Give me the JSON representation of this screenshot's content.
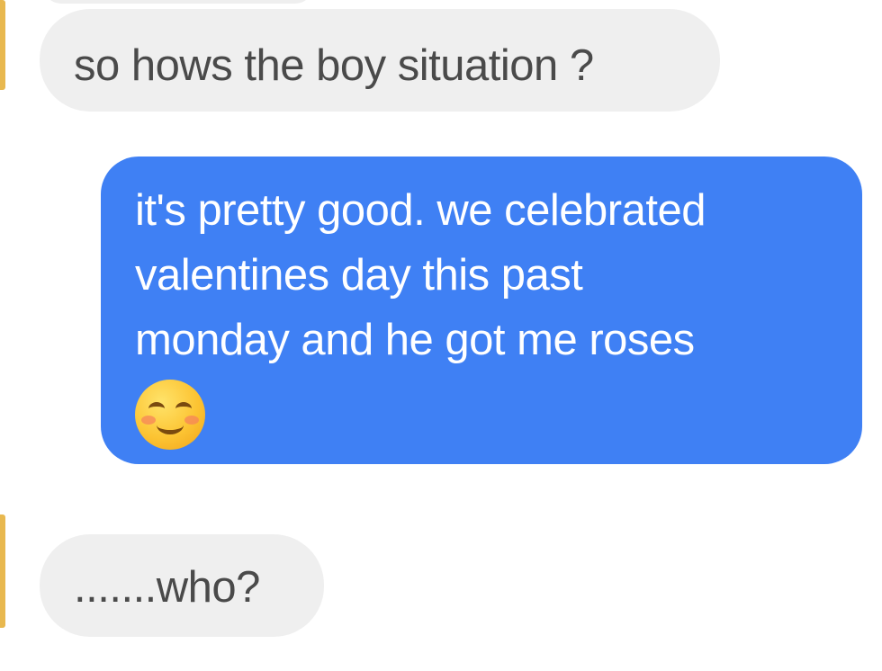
{
  "colors": {
    "sent_bubble": "#3f80f4",
    "received_bubble": "#efefef",
    "received_text": "#4a4a4a",
    "sent_text": "#ffffff",
    "avatar_accent": "#e8b84f"
  },
  "messages": [
    {
      "direction": "received",
      "text": "so hows the boy situation ?"
    },
    {
      "direction": "sent",
      "lines": [
        "it's pretty good. we celebrated",
        "valentines day this past",
        "monday and he got me roses"
      ],
      "emoji": "smiling-face-with-smiling-eyes"
    },
    {
      "direction": "received",
      "text": ".......who?"
    }
  ]
}
